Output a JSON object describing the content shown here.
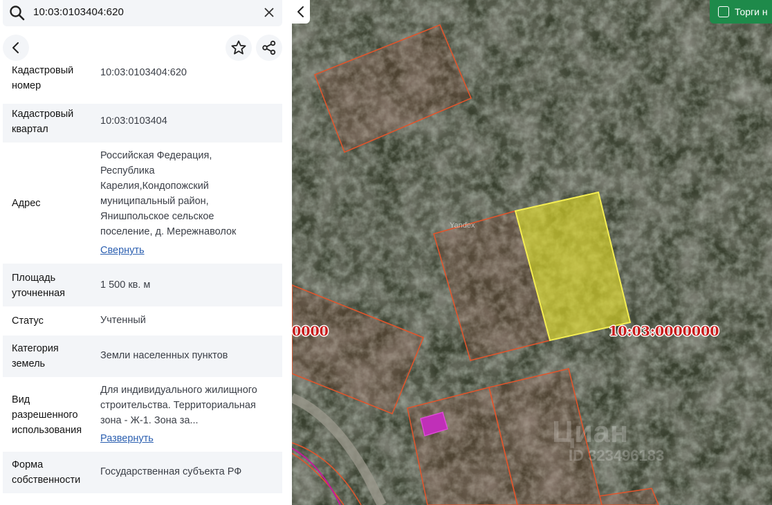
{
  "search": {
    "query": "10:03:0103404:620"
  },
  "icons": {
    "search": "search-icon",
    "clear": "close-icon",
    "back": "chevron-left-icon",
    "favorite": "star-icon",
    "share": "share-icon",
    "collapse": "chevron-left-icon"
  },
  "fields": [
    {
      "label": "Кадастровый номер",
      "value": "10:03:0103404:620"
    },
    {
      "label": "Кадастровый квартал",
      "value": "10:03:0103404"
    },
    {
      "label": "Адрес",
      "value": "Российская Федерация, Республика Карелия,Кондопожский муниципальный район, Янишпольское сельское поселение, д. Мережнаволок",
      "link": "Свернуть"
    },
    {
      "label": "Площадь уточненная",
      "value": "1 500 кв. м"
    },
    {
      "label": "Статус",
      "value": "Учтенный"
    },
    {
      "label": "Категория земель",
      "value": "Земли населенных пунктов"
    },
    {
      "label": "Вид разрешенного использования",
      "value": "Для индивидуального жилищного строительства. Территориальная зона - Ж-1. Зона за...",
      "link": "Развернуть"
    },
    {
      "label": "Форма собственности",
      "value": "Государственная субъекта РФ"
    }
  ],
  "map": {
    "torgi_label": "Торги н",
    "cad_label_main": "10:03:0000000",
    "cad_label_left": "0000",
    "yandex": "Yandex",
    "watermark": "Циан",
    "watermark_id": "ID 323496183",
    "colors": {
      "parcel_border": "#e0552c",
      "selected_fill": "#e8e23a",
      "selected_border": "#f4ee52",
      "accent": "#1e8a4a",
      "link": "#2b5fb0"
    }
  }
}
